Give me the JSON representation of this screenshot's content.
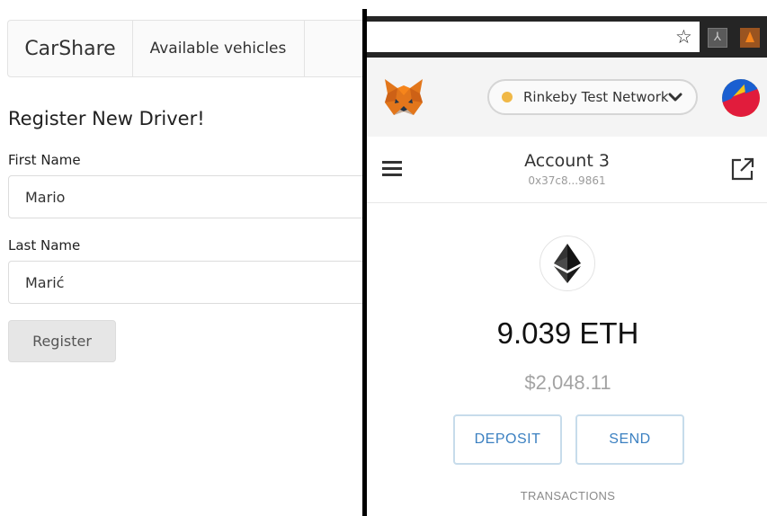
{
  "app": {
    "brand": "CarShare",
    "nav_link": "Available vehicles"
  },
  "form": {
    "title": "Register New Driver!",
    "first_name_label": "First Name",
    "first_name_value": "Mario",
    "last_name_label": "Last Name",
    "last_name_value": "Marić",
    "register_label": "Register"
  },
  "browser": {
    "icons": [
      "star-icon",
      "pdf-extension-icon",
      "metamask-extension-icon"
    ]
  },
  "metamask": {
    "network": "Rinkeby Test Network",
    "account_name": "Account 3",
    "account_address": "0x37c8...9861",
    "eth_balance": "9.039 ETH",
    "usd_balance": "$2,048.11",
    "deposit_label": "DEPOSIT",
    "send_label": "SEND",
    "transactions_label": "TRANSACTIONS",
    "colors": {
      "network_dot": "#f0b847",
      "button_text": "#3b80c1",
      "button_border": "#c7dceb"
    }
  }
}
